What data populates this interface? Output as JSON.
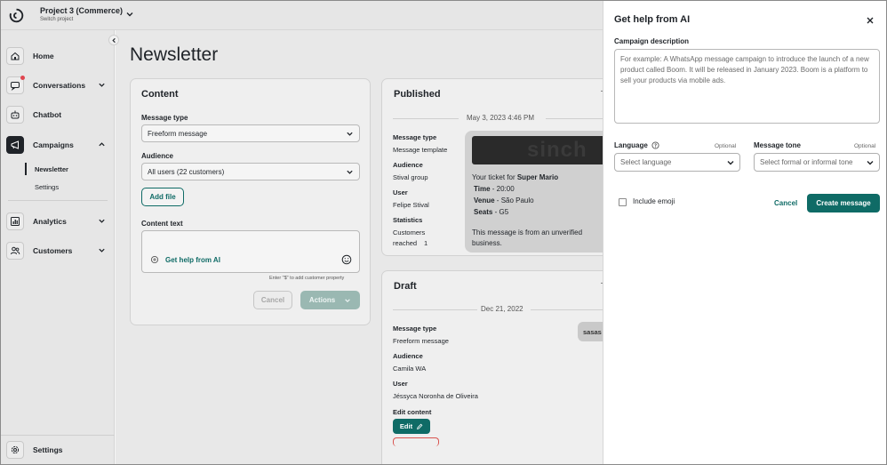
{
  "topbar": {
    "project_title": "Project 3 (Commerce)",
    "project_subtitle": "Switch project"
  },
  "sidebar": {
    "items": [
      {
        "label": "Home",
        "icon": "home-icon"
      },
      {
        "label": "Conversations",
        "icon": "chat-icon"
      },
      {
        "label": "Chatbot",
        "icon": "robot-icon"
      },
      {
        "label": "Campaigns",
        "icon": "megaphone-icon"
      },
      {
        "label": "Analytics",
        "icon": "chart-icon"
      },
      {
        "label": "Customers",
        "icon": "users-icon"
      }
    ],
    "campaign_sub": [
      "Newsletter",
      "Settings"
    ],
    "settings_label": "Settings"
  },
  "main": {
    "page_title": "Newsletter",
    "content_card": {
      "title": "Content",
      "message_type_label": "Message type",
      "message_type_value": "Freeform message",
      "audience_label": "Audience",
      "audience_value": "All users (22 customers)",
      "add_file": "Add file",
      "content_text_label": "Content text",
      "get_help": "Get help from AI",
      "hint": "Enter \"$\" to add customer property",
      "cancel": "Cancel",
      "actions": "Actions"
    },
    "published_card": {
      "title": "Published",
      "date": "May 3, 2023 4:46 PM",
      "fields": [
        {
          "label": "Message type",
          "value": "Message template"
        },
        {
          "label": "Audience",
          "value": "Stival group"
        },
        {
          "label": "User",
          "value": "Felipe Stival"
        }
      ],
      "statistics_label": "Statistics",
      "statistics_value_1": "Customers",
      "statistics_value_2": "reached",
      "statistics_count": "1",
      "preview": {
        "image_text": "sinch",
        "line1_prefix": "Your ticket for ",
        "line1_bold": "Super Mario",
        "time_label": "Time",
        "time_value": " - 20:00",
        "venue_label": "Venue",
        "venue_value": " - São Paulo",
        "seats_label": "Seats",
        "seats_value": " - G5",
        "footer_1": "This message is from an unverified",
        "footer_2": "business."
      }
    },
    "draft_card": {
      "title": "Draft",
      "date": "Dec 21, 2022",
      "fields": [
        {
          "label": "Message type",
          "value": "Freeform message"
        },
        {
          "label": "Audience",
          "value": "Camila WA"
        },
        {
          "label": "User",
          "value": "Jéssyca Noronha de Oliveira"
        }
      ],
      "edit_content_label": "Edit content",
      "edit_button": "Edit",
      "bubble_text": "sasas"
    }
  },
  "drawer": {
    "title": "Get help from AI",
    "campaign_description_label": "Campaign description",
    "campaign_description_placeholder": "For example: A WhatsApp message campaign to introduce the launch of a new product called Boom. It will be released in January 2023. Boom is a platform to sell your products via mobile ads.",
    "language_label": "Language",
    "language_optional": "Optional",
    "language_placeholder": "Select language",
    "tone_label": "Message tone",
    "tone_optional": "Optional",
    "tone_placeholder": "Select formal or informal tone",
    "include_emoji": "Include emoji",
    "cancel": "Cancel",
    "create": "Create message"
  },
  "colors": {
    "accent": "#0f6b66",
    "badge_red": "#e0454f"
  }
}
